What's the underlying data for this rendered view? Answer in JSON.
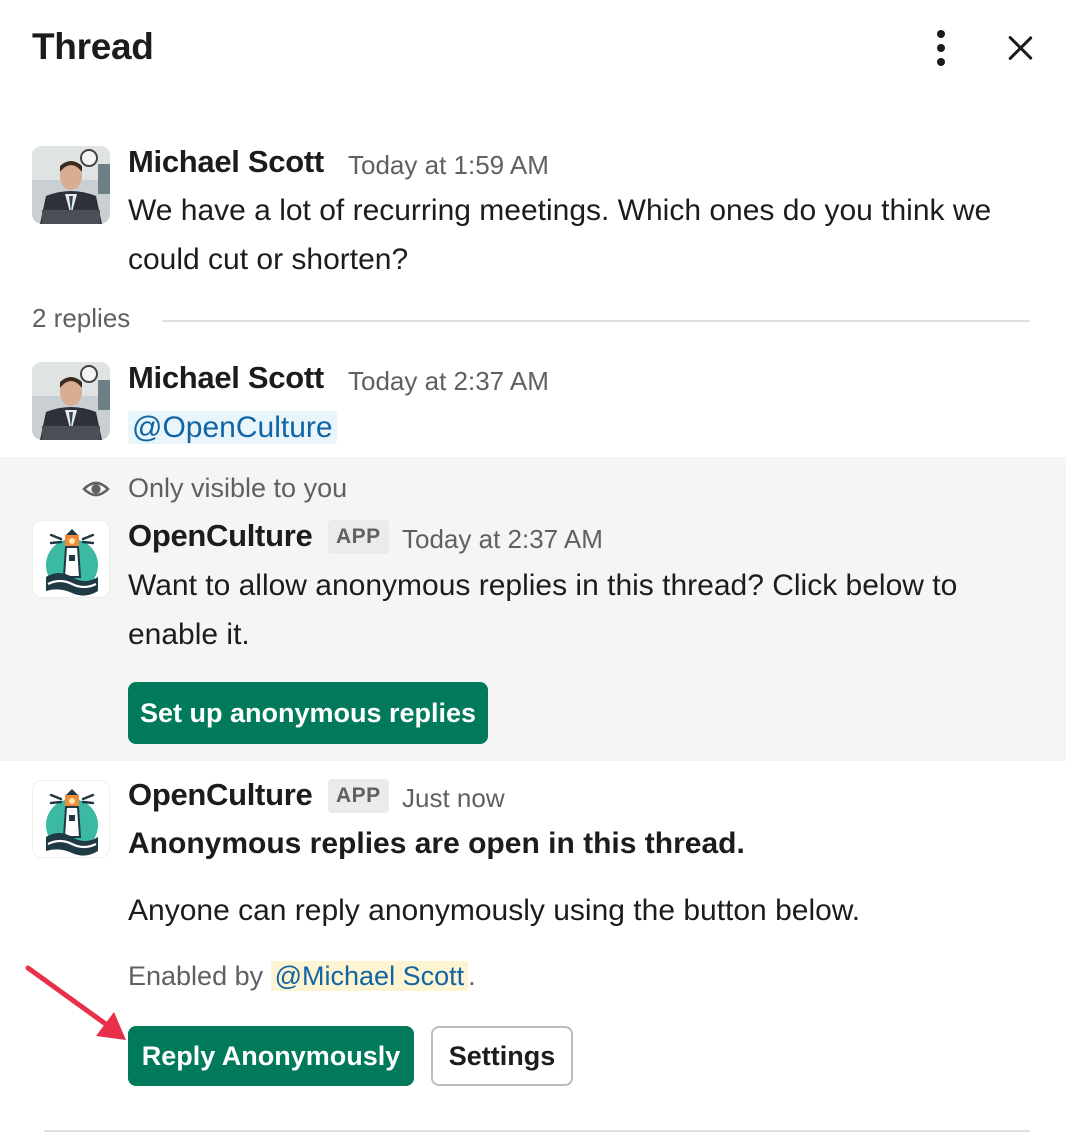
{
  "header": {
    "title": "Thread",
    "more_icon": "kebab-vertical-icon",
    "close_icon": "close-icon"
  },
  "colors": {
    "primary_button": "#007a5a",
    "link": "#1264a3",
    "mention_bg": "#e8f5fa",
    "self_mention_bg": "#fdf4d2",
    "ephemeral_bg": "#f5f5f5",
    "arrow": "#e8304a"
  },
  "parent_message": {
    "author": "Michael Scott",
    "timestamp": "Today at 1:59 AM",
    "text": "We have a lot of recurring meetings. Which ones do you think we could cut or shorten?"
  },
  "replies": {
    "count_label": "2 replies"
  },
  "reply_1": {
    "author": "Michael Scott",
    "timestamp": "Today at 2:37 AM",
    "mention": "@OpenCulture"
  },
  "ephemeral": {
    "visibility_label": "Only visible to you",
    "visibility_icon": "eye-icon",
    "author": "OpenCulture",
    "badge": "APP",
    "timestamp": "Today at 2:37 AM",
    "text": "Want to allow anonymous replies in this thread? Click below to enable it.",
    "button_label": "Set up anonymous replies"
  },
  "reply_2": {
    "author": "OpenCulture",
    "badge": "APP",
    "timestamp": "Just now",
    "headline": "Anonymous replies are open in this thread.",
    "body": "Anyone can reply anonymously using the button below.",
    "enabled_by_prefix": "Enabled by",
    "enabled_by_mention": "@Michael Scott",
    "enabled_by_suffix": ".",
    "primary_button_label": "Reply Anonymously",
    "secondary_button_label": "Settings"
  }
}
